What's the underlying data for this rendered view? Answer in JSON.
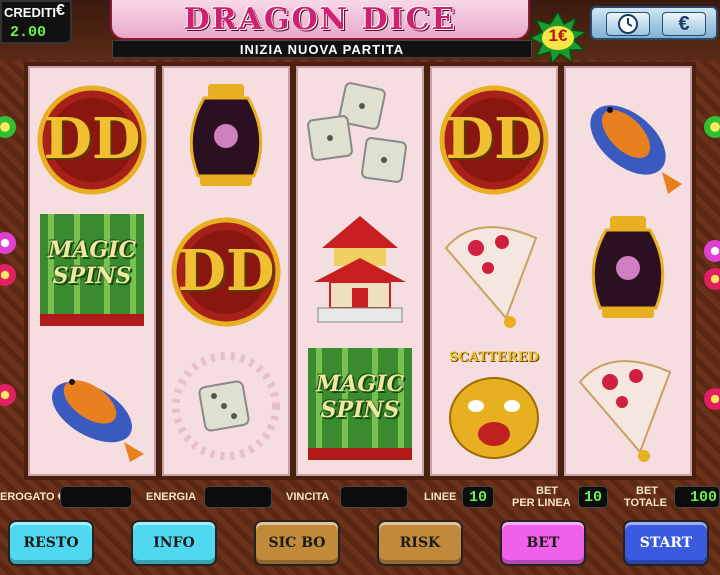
{
  "credit": {
    "label": "CREDITI",
    "currency": "€",
    "value": "2.00"
  },
  "title": "DRAGON DICE",
  "status": "INIZIA NUOVA PARTITA",
  "bet_badge": "1€",
  "top_icons": {
    "clock": "clock-icon",
    "euro": "€"
  },
  "reels": [
    [
      "dd-logo",
      "magic-spins",
      "koi-fish"
    ],
    [
      "vase",
      "dd-logo",
      "dice"
    ],
    [
      "dice",
      "pagoda",
      "magic-spins"
    ],
    [
      "dd-logo",
      "fan",
      "scattered-dragon"
    ],
    [
      "koi-fish",
      "vase",
      "fan"
    ]
  ],
  "symbols": {
    "magic_spins_line1": "MAGIC",
    "magic_spins_line2": "SPINS",
    "scattered": "SCATTERED",
    "dd": "DD"
  },
  "info": {
    "erogato_label": "EROGATO €",
    "erogato_value": "",
    "energia_label": "ENERGIA",
    "energia_value": "",
    "vincita_label": "VINCITA",
    "vincita_value": "",
    "linee_label": "LINEE",
    "linee_value": "10",
    "bet_per_linea_label1": "BET",
    "bet_per_linea_label2": "PER LINEA",
    "bet_per_linea_value": "10",
    "bet_totale_label1": "BET",
    "bet_totale_label2": "TOTALE",
    "bet_totale_value": "100"
  },
  "buttons": {
    "resto": "RESTO",
    "info": "INFO",
    "sicbo": "SIC BO",
    "risk": "RISK",
    "bet": "BET",
    "start": "START"
  },
  "colors": {
    "resto": "#4fd8f0",
    "info": "#4fd8f0",
    "sicbo": "#c08a3a",
    "risk": "#c08a3a",
    "bet": "#f060e8",
    "start": "#3a5ae0",
    "digits": "#6cf04a"
  }
}
